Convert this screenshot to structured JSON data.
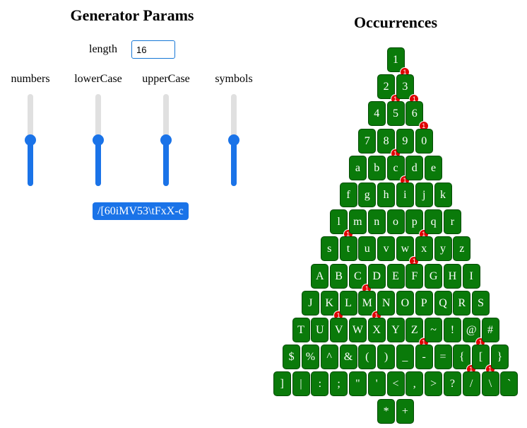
{
  "generator": {
    "title": "Generator Params",
    "length_label": "length",
    "length_value": "16",
    "sliders": [
      {
        "label": "numbers",
        "level": 0.5
      },
      {
        "label": "lowerCase",
        "level": 0.5
      },
      {
        "label": "upperCase",
        "level": 0.5
      },
      {
        "label": "symbols",
        "level": 0.5
      }
    ],
    "password": "/[60iMV53\\tFxX-c"
  },
  "occurrences": {
    "title": "Occurrences",
    "rows": [
      [
        {
          "c": "1",
          "n": 1
        }
      ],
      [
        {
          "c": "2",
          "n": 1
        },
        {
          "c": "3",
          "n": 1
        }
      ],
      [
        {
          "c": "4"
        },
        {
          "c": "5"
        },
        {
          "c": "6",
          "n": 1
        }
      ],
      [
        {
          "c": "7"
        },
        {
          "c": "8",
          "n": 1
        },
        {
          "c": "9"
        },
        {
          "c": "0"
        }
      ],
      [
        {
          "c": "a"
        },
        {
          "c": "b"
        },
        {
          "c": "c",
          "n": 1
        },
        {
          "c": "d"
        },
        {
          "c": "e"
        }
      ],
      [
        {
          "c": "f"
        },
        {
          "c": "g"
        },
        {
          "c": "h"
        },
        {
          "c": "i"
        },
        {
          "c": "j"
        },
        {
          "c": "k"
        }
      ],
      [
        {
          "c": "l",
          "n": 1
        },
        {
          "c": "m"
        },
        {
          "c": "n"
        },
        {
          "c": "o"
        },
        {
          "c": "p",
          "n": 1
        },
        {
          "c": "q"
        },
        {
          "c": "r"
        }
      ],
      [
        {
          "c": "s"
        },
        {
          "c": "t"
        },
        {
          "c": "u"
        },
        {
          "c": "v"
        },
        {
          "c": "w",
          "n": 1
        },
        {
          "c": "x"
        },
        {
          "c": "y"
        },
        {
          "c": "z"
        }
      ],
      [
        {
          "c": "A"
        },
        {
          "c": "B"
        },
        {
          "c": "C",
          "n": 1
        },
        {
          "c": "D"
        },
        {
          "c": "E"
        },
        {
          "c": "F"
        },
        {
          "c": "G"
        },
        {
          "c": "H"
        },
        {
          "c": "I"
        }
      ],
      [
        {
          "c": "J"
        },
        {
          "c": "K",
          "n": 1
        },
        {
          "c": "L"
        },
        {
          "c": "M",
          "n": 1
        },
        {
          "c": "N"
        },
        {
          "c": "O"
        },
        {
          "c": "P"
        },
        {
          "c": "Q"
        },
        {
          "c": "R"
        },
        {
          "c": "S"
        }
      ],
      [
        {
          "c": "T"
        },
        {
          "c": "U"
        },
        {
          "c": "V"
        },
        {
          "c": "W"
        },
        {
          "c": "X"
        },
        {
          "c": "Y"
        },
        {
          "c": "Z",
          "n": 1
        },
        {
          "c": "~"
        },
        {
          "c": "!"
        },
        {
          "c": "@",
          "n": 1
        },
        {
          "c": "#"
        }
      ],
      [
        {
          "c": "$"
        },
        {
          "c": "%"
        },
        {
          "c": "^"
        },
        {
          "c": "&"
        },
        {
          "c": "("
        },
        {
          "c": ")"
        },
        {
          "c": "_"
        },
        {
          "c": "-"
        },
        {
          "c": "="
        },
        {
          "c": "{",
          "n": 1
        },
        {
          "c": "[",
          "n": 1
        },
        {
          "c": "}"
        }
      ],
      [
        {
          "c": "]"
        },
        {
          "c": "|"
        },
        {
          "c": ":"
        },
        {
          "c": ";"
        },
        {
          "c": "\""
        },
        {
          "c": "'"
        },
        {
          "c": "<"
        },
        {
          "c": ","
        },
        {
          "c": ">"
        },
        {
          "c": "?"
        },
        {
          "c": "/"
        },
        {
          "c": "\\"
        },
        {
          "c": "`"
        }
      ],
      [
        {
          "c": "*"
        },
        {
          "c": "+"
        }
      ]
    ]
  }
}
